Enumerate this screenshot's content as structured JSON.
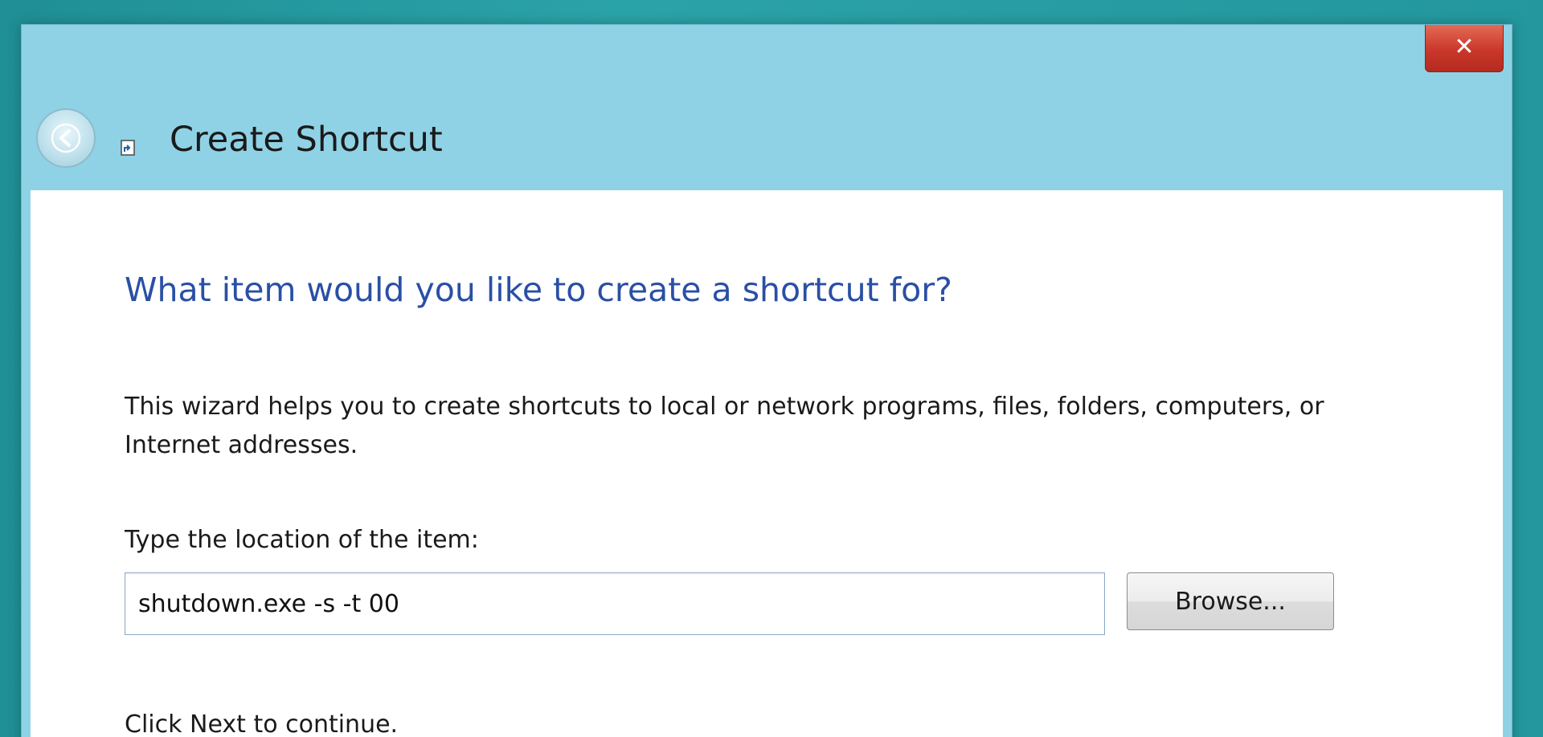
{
  "window": {
    "close_label": "✕",
    "title": "Create Shortcut"
  },
  "wizard": {
    "heading": "What item would you like to create a shortcut for?",
    "description": "This wizard helps you to create shortcuts to local or network programs, files, folders, computers, or Internet addresses.",
    "location_label": "Type the location of the item:",
    "location_value": "shutdown.exe -s -t 00",
    "browse_label": "Browse...",
    "next_hint": "Click Next to continue."
  },
  "icons": {
    "back": "back-arrow-icon",
    "close": "close-icon",
    "wizard": "shortcut-icon"
  },
  "colors": {
    "title_bar": "#8fd2e6",
    "heading": "#2a4fa5",
    "close_button": "#c9372a",
    "desktop": "#2aa3a8"
  }
}
